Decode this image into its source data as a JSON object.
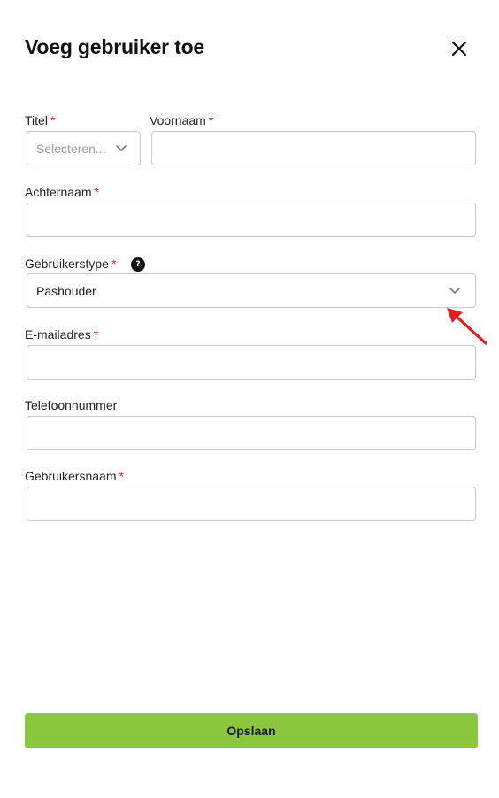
{
  "dialog": {
    "title": "Voeg gebruiker toe",
    "close_icon": "close-icon"
  },
  "form": {
    "required_mark": "*",
    "titel": {
      "label": "Titel",
      "required": true,
      "placeholder": "Selecteren...",
      "value": ""
    },
    "voornaam": {
      "label": "Voornaam",
      "required": true,
      "value": ""
    },
    "achternaam": {
      "label": "Achternaam",
      "required": true,
      "value": ""
    },
    "gebruikerstype": {
      "label": "Gebruikerstype",
      "required": true,
      "help_icon": "question-icon",
      "help_glyph": "?",
      "value": "Pashouder"
    },
    "emailadres": {
      "label": "E-mailadres",
      "required": true,
      "value": ""
    },
    "telefoonnummer": {
      "label": "Telefoonnummer",
      "required": false,
      "value": ""
    },
    "gebruikersnaam": {
      "label": "Gebruikersnaam",
      "required": true,
      "value": ""
    }
  },
  "footer": {
    "save_label": "Opslaan"
  },
  "annotation": {
    "icon": "red-arrow-icon",
    "color": "#e02020"
  },
  "colors": {
    "accent": "#8bc63f",
    "required": "#e0263a",
    "border": "#c9c9c9"
  }
}
